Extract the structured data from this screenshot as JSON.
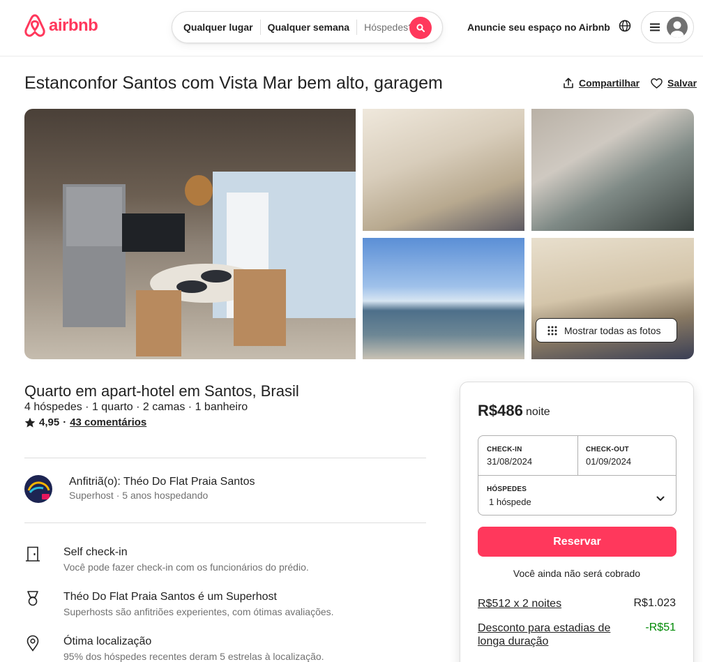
{
  "header": {
    "logo_text": "airbnb",
    "search": {
      "location": "Qualquer lugar",
      "week": "Qualquer semana",
      "guests": "Hóspedes?"
    },
    "host_link": "Anuncie seu espaço no Airbnb",
    "brand_color": "#ff385c"
  },
  "listing": {
    "title": "Estanconfor Santos com Vista Mar bem alto, garagem",
    "share_label": "Compartilhar",
    "save_label": "Salvar",
    "show_all_photos": "Mostrar todas as fotos",
    "room_title": "Quarto em apart-hotel em Santos, Brasil",
    "facts": "4 hóspedes · 1 quarto · 2 camas · 1 banheiro",
    "rating": "4,95",
    "separator": "·",
    "reviews": "43 comentários"
  },
  "host": {
    "name": "Anfitriã(o): Théo Do Flat Praia Santos",
    "sub": "Superhost · 5 anos hospedando"
  },
  "features": [
    {
      "icon": "door-icon",
      "title": "Self check-in",
      "sub": "Você pode fazer check-in com os funcionários do prédio."
    },
    {
      "icon": "medal-icon",
      "title": "Théo Do Flat Praia Santos é um Superhost",
      "sub": "Superhosts são anfitriões experientes, com ótimas avaliações."
    },
    {
      "icon": "location-pin-icon",
      "title": "Ótima localização",
      "sub": "95% dos hóspedes recentes deram 5 estrelas à localização."
    }
  ],
  "booking": {
    "price": "R$486",
    "per": "noite",
    "checkin_label": "CHECK-IN",
    "checkin_value": "31/08/2024",
    "checkout_label": "CHECK-OUT",
    "checkout_value": "01/09/2024",
    "guests_label": "HÓSPEDES",
    "guests_value": "1 hóspede",
    "reserve_label": "Reservar",
    "no_charge": "Você ainda não será cobrado",
    "fees": [
      {
        "label": "R$512 x 2 noites",
        "value": "R$1.023"
      },
      {
        "label": "Desconto para estadias de longa duração",
        "value": "-R$51"
      }
    ]
  }
}
